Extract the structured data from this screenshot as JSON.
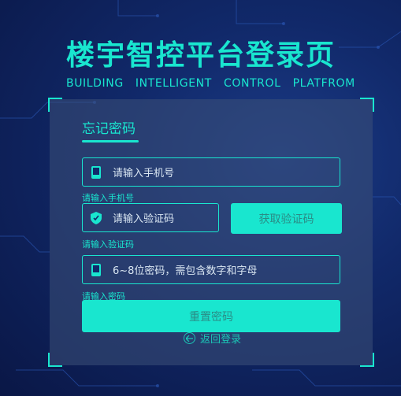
{
  "header": {
    "title": "楼宇智控平台登录页",
    "subtitle": "BUILDING  INTELLIGENT  CONTROL  PLATFROM"
  },
  "form": {
    "tab_label": "忘记密码",
    "phone": {
      "placeholder": "请输入手机号",
      "hint": "请输入手机号",
      "icon": "phone-icon"
    },
    "code": {
      "placeholder": "请输入验证码",
      "hint": "请输入验证码",
      "icon": "shield-icon",
      "button_label": "获取验证码"
    },
    "password": {
      "placeholder": "6~8位密码，需包含数字和字母",
      "hint": "请输入密码",
      "icon": "phone-icon"
    },
    "submit_label": "重置密码",
    "back_label": "返回登录"
  },
  "colors": {
    "accent": "#19e6cf",
    "background": "#11296a",
    "panel": "#3c5078"
  }
}
